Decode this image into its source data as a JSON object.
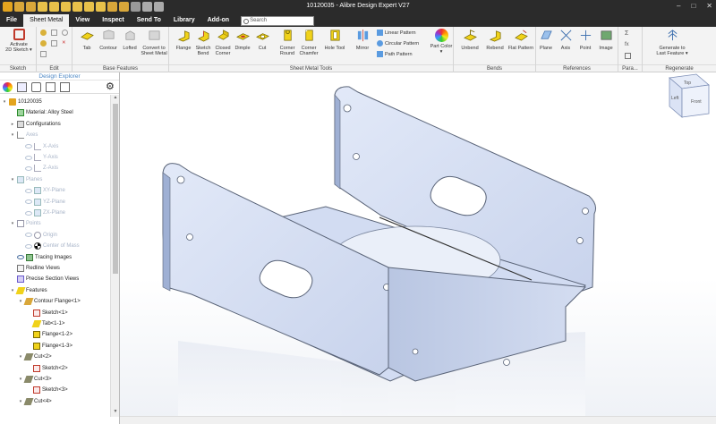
{
  "window": {
    "title": "10120035 - Alibre Design Expert V27"
  },
  "menu": {
    "tabs": [
      "File",
      "Sheet Metal",
      "View",
      "Inspect",
      "Send To",
      "Library",
      "Add-on"
    ],
    "active": "Sheet Metal",
    "search_placeholder": "Search"
  },
  "ribbon": {
    "groups": [
      "Sketch",
      "Edit",
      "Base Features",
      "Sheet Metal Tools",
      "Bends",
      "References",
      "Para...",
      "Regenerate"
    ],
    "sketch": {
      "activate": [
        "Activate",
        "2D Sketch ▾"
      ]
    },
    "base": {
      "tab": "Tab",
      "contour": "Contour",
      "lofted": "Lofted",
      "convert": [
        "Convert to",
        "Sheet Metal"
      ]
    },
    "tools": {
      "flange": "Flange",
      "sketch_bend": [
        "Sketch",
        "Bend"
      ],
      "closed_corner": [
        "Closed",
        "Corner"
      ],
      "dimple": "Dimple",
      "cut": "Cut",
      "corner_round": [
        "Corner",
        "Round"
      ],
      "corner_chamfer": [
        "Corner",
        "Chamfer"
      ],
      "hole_tool": "Hole Tool",
      "mirror": "Mirror",
      "linear_pattern": "Linear Pattern",
      "circular_pattern": "Circular Pattern",
      "path_pattern": "Path Pattern",
      "part_color": [
        "Part Color",
        "▾"
      ]
    },
    "bends": {
      "unbend": "Unbend",
      "rebend": "Rebend",
      "flat_pattern": "Flat Pattern"
    },
    "references": {
      "plane": "Plane",
      "axis": "Axis",
      "point": "Point",
      "image": "Image"
    },
    "regen": {
      "generate": [
        "Generate to",
        "Last Feature ▾"
      ]
    }
  },
  "explorer": {
    "title": "Design Explorer",
    "tree": [
      {
        "label": "10120035",
        "level": 0,
        "toggle": "▾",
        "icon": "part",
        "dim": false
      },
      {
        "label": "Material: Alloy Steel",
        "level": 1,
        "toggle": "",
        "icon": "material",
        "dim": false
      },
      {
        "label": "Configurations",
        "level": 1,
        "toggle": "▸",
        "icon": "config",
        "dim": false
      },
      {
        "label": "Axes",
        "level": 1,
        "toggle": "▾",
        "icon": "axes",
        "dim": true
      },
      {
        "label": "X-Axis",
        "level": 2,
        "toggle": "",
        "icon": "axis",
        "dim": true
      },
      {
        "label": "Y-Axis",
        "level": 2,
        "toggle": "",
        "icon": "axis",
        "dim": true
      },
      {
        "label": "Z-Axis",
        "level": 2,
        "toggle": "",
        "icon": "axis",
        "dim": true
      },
      {
        "label": "Planes",
        "level": 1,
        "toggle": "▾",
        "icon": "planes",
        "dim": true
      },
      {
        "label": "XY-Plane",
        "level": 2,
        "toggle": "",
        "icon": "plane",
        "dim": true
      },
      {
        "label": "YZ-Plane",
        "level": 2,
        "toggle": "",
        "icon": "plane",
        "dim": true
      },
      {
        "label": "ZX-Plane",
        "level": 2,
        "toggle": "",
        "icon": "plane",
        "dim": true
      },
      {
        "label": "Points",
        "level": 1,
        "toggle": "▾",
        "icon": "points",
        "dim": true
      },
      {
        "label": "Origin",
        "level": 2,
        "toggle": "",
        "icon": "point",
        "dim": true
      },
      {
        "label": "Center of Mass",
        "level": 2,
        "toggle": "",
        "icon": "com",
        "dim": true
      },
      {
        "label": "Tracing Images",
        "level": 1,
        "toggle": "",
        "icon": "image",
        "dim": false
      },
      {
        "label": "Redline Views",
        "level": 1,
        "toggle": "",
        "icon": "redline",
        "dim": false
      },
      {
        "label": "Precise Section Views",
        "level": 1,
        "toggle": "",
        "icon": "section",
        "dim": false
      },
      {
        "label": "Features",
        "level": 1,
        "toggle": "▾",
        "icon": "features",
        "dim": false
      },
      {
        "label": "Contour Flange<1>",
        "level": 2,
        "toggle": "▾",
        "icon": "contour",
        "dim": false
      },
      {
        "label": "Sketch<1>",
        "level": 3,
        "toggle": "",
        "icon": "sketch",
        "dim": false
      },
      {
        "label": "Tab<1-1>",
        "level": 3,
        "toggle": "",
        "icon": "tab",
        "dim": false
      },
      {
        "label": "Flange<1-2>",
        "level": 3,
        "toggle": "",
        "icon": "flange",
        "dim": false
      },
      {
        "label": "Flange<1-3>",
        "level": 3,
        "toggle": "",
        "icon": "flange",
        "dim": false
      },
      {
        "label": "Cut<2>",
        "level": 2,
        "toggle": "▾",
        "icon": "cut",
        "dim": false
      },
      {
        "label": "Sketch<2>",
        "level": 3,
        "toggle": "",
        "icon": "sketch",
        "dim": false
      },
      {
        "label": "Cut<3>",
        "level": 2,
        "toggle": "▾",
        "icon": "cut",
        "dim": false
      },
      {
        "label": "Sketch<3>",
        "level": 3,
        "toggle": "",
        "icon": "sketch",
        "dim": false
      },
      {
        "label": "Cut<4>",
        "level": 2,
        "toggle": "▾",
        "icon": "cut",
        "dim": false
      }
    ]
  },
  "viewcube": {
    "top": "Top",
    "left": "Left",
    "front": "Front"
  },
  "colors": {
    "part_face": "#d9e2f5",
    "part_edge": "#5a6478",
    "titlebar": "#2b2b2b",
    "accent": "#4a86c5"
  }
}
